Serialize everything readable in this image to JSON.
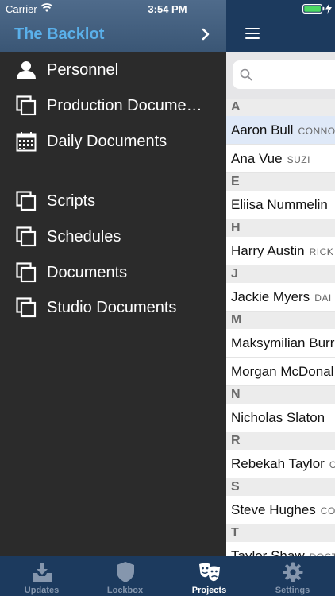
{
  "status_bar": {
    "carrier": "Carrier",
    "time": "3:54 PM"
  },
  "drawer": {
    "title": "The Backlot",
    "items": [
      {
        "label": "Personnel",
        "icon": "person-icon"
      },
      {
        "label": "Production Docume…",
        "icon": "documents-icon"
      },
      {
        "label": "Daily Documents",
        "icon": "calendar-icon"
      },
      {
        "label": "Scripts",
        "icon": "documents-icon"
      },
      {
        "label": "Schedules",
        "icon": "documents-icon"
      },
      {
        "label": "Documents",
        "icon": "documents-icon"
      },
      {
        "label": "Studio Documents",
        "icon": "documents-icon"
      }
    ]
  },
  "contacts": {
    "sections": [
      {
        "letter": "A",
        "rows": [
          {
            "name": "Aaron Bull",
            "role": "CONNO",
            "selected": true
          },
          {
            "name": "Ana Vue",
            "role": "SUZI"
          }
        ]
      },
      {
        "letter": "E",
        "rows": [
          {
            "name": "Eliisa Nummelin",
            "role": ""
          }
        ]
      },
      {
        "letter": "H",
        "rows": [
          {
            "name": "Harry Austin",
            "role": "RICK"
          }
        ]
      },
      {
        "letter": "J",
        "rows": [
          {
            "name": "Jackie Myers",
            "role": "DAI"
          }
        ]
      },
      {
        "letter": "M",
        "rows": [
          {
            "name": "Maksymilian Burr",
            "role": ""
          },
          {
            "name": "Morgan McDonal",
            "role": ""
          }
        ]
      },
      {
        "letter": "N",
        "rows": [
          {
            "name": "Nicholas Slaton",
            "role": ""
          }
        ]
      },
      {
        "letter": "R",
        "rows": [
          {
            "name": "Rebekah Taylor",
            "role": "CL"
          }
        ]
      },
      {
        "letter": "S",
        "rows": [
          {
            "name": "Steve Hughes",
            "role": "CO"
          }
        ]
      },
      {
        "letter": "T",
        "rows": [
          {
            "name": "Taylor Shaw",
            "role": "DOCT"
          }
        ]
      }
    ]
  },
  "tabs": [
    {
      "label": "Updates",
      "icon": "download-tray-icon",
      "active": false
    },
    {
      "label": "Lockbox",
      "icon": "shield-icon",
      "active": false
    },
    {
      "label": "Projects",
      "icon": "theater-masks-icon",
      "active": true
    },
    {
      "label": "Settings",
      "icon": "gear-icon",
      "active": false
    }
  ],
  "colors": {
    "nav": "#1c3a5e",
    "drawer": "#2b2b2b",
    "accent": "#5ab0ea"
  }
}
